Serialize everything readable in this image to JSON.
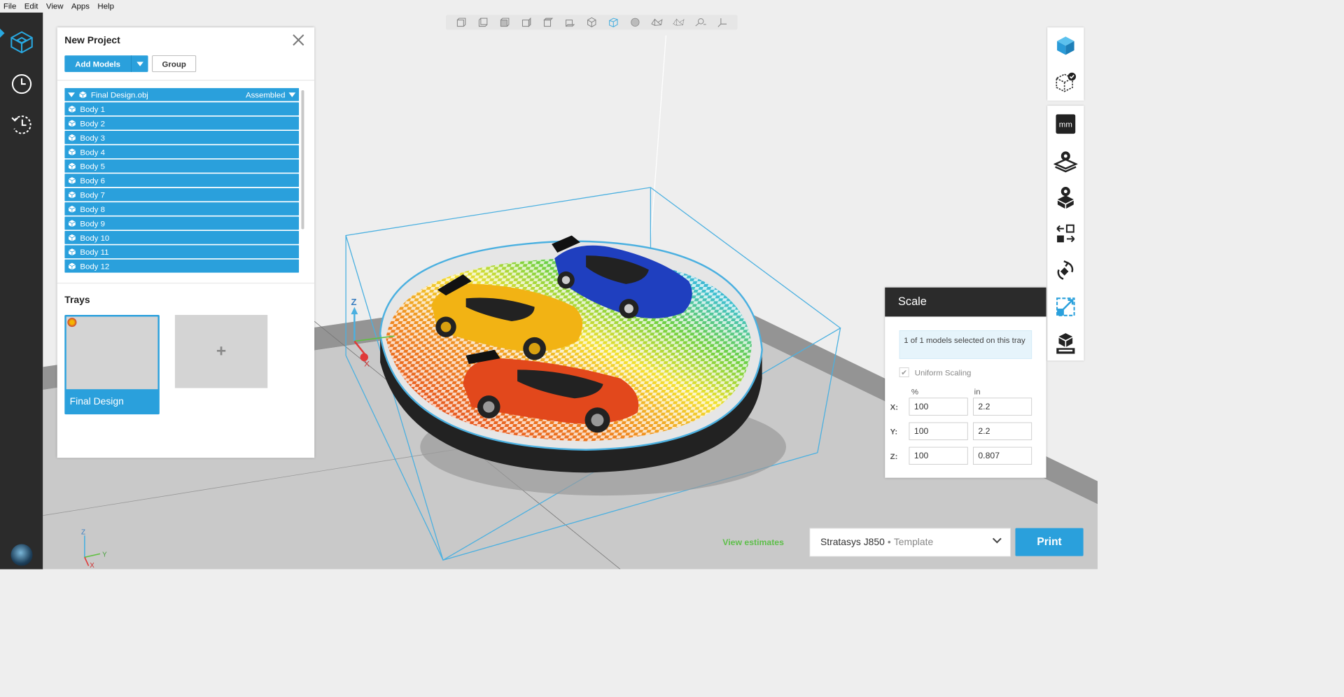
{
  "menu": {
    "file": "File",
    "edit": "Edit",
    "view": "View",
    "apps": "Apps",
    "help": "Help"
  },
  "project": {
    "title": "New Project",
    "add_models_label": "Add Models",
    "group_label": "Group",
    "tree_root": {
      "name": "Final Design.obj",
      "mode": "Assembled"
    },
    "bodies": [
      "Body 1",
      "Body 2",
      "Body 3",
      "Body 4",
      "Body 5",
      "Body 6",
      "Body 7",
      "Body 8",
      "Body 9",
      "Body 10",
      "Body 11",
      "Body 12"
    ],
    "trays_title": "Trays",
    "tray_name": "Final Design",
    "tray_add_symbol": "+"
  },
  "scale": {
    "title": "Scale",
    "info": "1 of 1 models selected on this tray",
    "uniform_label": "Uniform Scaling",
    "uniform_checked": true,
    "col_percent": "%",
    "col_unit": "in",
    "x_label": "X:",
    "y_label": "Y:",
    "z_label": "Z:",
    "x_percent": "100",
    "x_value": "2.2",
    "y_percent": "100",
    "y_value": "2.2",
    "z_percent": "100",
    "z_value": "0.807"
  },
  "units_badge": "mm",
  "axes": {
    "z": "Z",
    "x": "X",
    "y": "Y"
  },
  "estimates_label": "View estimates",
  "printer": {
    "name": "Stratasys J850",
    "sep": "•",
    "template": "Template"
  },
  "print_label": "Print",
  "colors": {
    "accent": "#2aa0dc",
    "sidebar": "#2b2b2b",
    "estimates": "#5fbf4b",
    "tray_box": "#4bb0e0"
  },
  "icons": [
    "project-icon",
    "clock-icon",
    "history-icon",
    "cube-icon",
    "model-check-icon",
    "units-icon",
    "tray-settings-icon",
    "model-settings-icon",
    "arrange-icon",
    "rotate-icon",
    "scale-icon",
    "print-settings-icon"
  ]
}
